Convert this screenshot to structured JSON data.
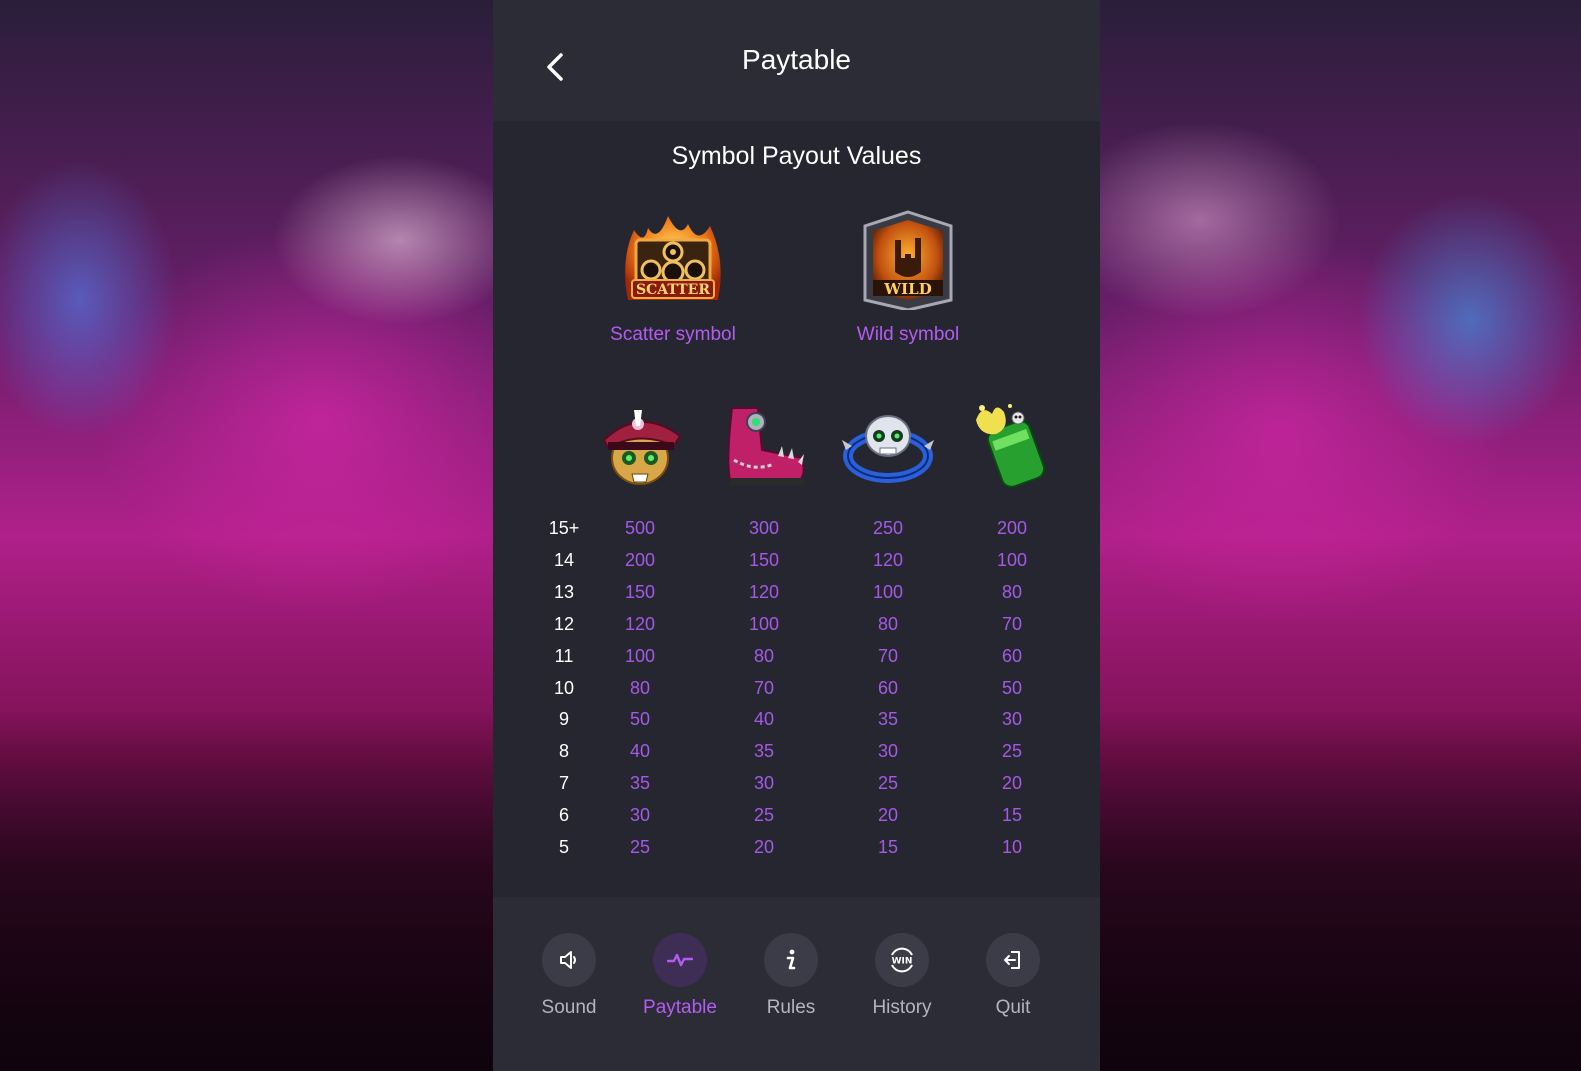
{
  "header": {
    "title": "Paytable"
  },
  "content": {
    "subtitle": "Symbol Payout Values",
    "special_symbols": [
      {
        "icon": "scatter-speakers-icon",
        "label": "Scatter symbol",
        "image_text": "SCATTER"
      },
      {
        "icon": "wild-rock-hand-icon",
        "label": "Wild symbol",
        "image_text": "WILD"
      }
    ],
    "symbols": [
      "skull-captain-hat-icon",
      "pink-spiked-boot-icon",
      "skull-spiked-bracelet-icon",
      "green-beer-can-icon"
    ],
    "table": {
      "rows": [
        {
          "count": "15+",
          "values": [
            "500",
            "300",
            "250",
            "200"
          ]
        },
        {
          "count": "14",
          "values": [
            "200",
            "150",
            "120",
            "100"
          ]
        },
        {
          "count": "13",
          "values": [
            "150",
            "120",
            "100",
            "80"
          ]
        },
        {
          "count": "12",
          "values": [
            "120",
            "100",
            "80",
            "70"
          ]
        },
        {
          "count": "11",
          "values": [
            "100",
            "80",
            "70",
            "60"
          ]
        },
        {
          "count": "10",
          "values": [
            "80",
            "70",
            "60",
            "50"
          ]
        },
        {
          "count": "9",
          "values": [
            "50",
            "40",
            "35",
            "30"
          ]
        },
        {
          "count": "8",
          "values": [
            "40",
            "35",
            "30",
            "25"
          ]
        },
        {
          "count": "7",
          "values": [
            "35",
            "30",
            "25",
            "20"
          ]
        },
        {
          "count": "6",
          "values": [
            "30",
            "25",
            "20",
            "15"
          ]
        },
        {
          "count": "5",
          "values": [
            "25",
            "20",
            "15",
            "10"
          ]
        }
      ]
    }
  },
  "footer": {
    "items": [
      {
        "label": "Sound",
        "icon": "speaker-icon",
        "active": false
      },
      {
        "label": "Paytable",
        "icon": "pulse-icon",
        "active": true
      },
      {
        "label": "Rules",
        "icon": "info-icon",
        "active": false
      },
      {
        "label": "History",
        "icon": "win-icon",
        "icon_text": "WIN",
        "active": false
      },
      {
        "label": "Quit",
        "icon": "exit-icon",
        "active": false
      }
    ]
  },
  "colors": {
    "accent": "#b45cf0",
    "value_text": "#a45ae4",
    "panel_bg": "#262630",
    "header_bg": "#2c2c37"
  }
}
